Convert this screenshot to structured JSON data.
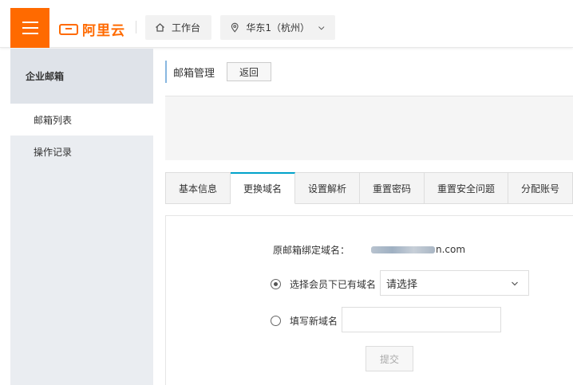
{
  "header": {
    "logo_text": "阿里云",
    "workbench_label": "工作台",
    "region_label": "华东1（杭州）"
  },
  "sidebar": {
    "title": "企业邮箱",
    "items": [
      {
        "label": "邮箱列表",
        "active": true
      },
      {
        "label": "操作记录",
        "active": false
      }
    ]
  },
  "main": {
    "page_title": "邮箱管理",
    "back_label": "返回",
    "tabs": [
      {
        "label": "基本信息",
        "active": false
      },
      {
        "label": "更换域名",
        "active": true
      },
      {
        "label": "设置解析",
        "active": false
      },
      {
        "label": "重置密码",
        "active": false
      },
      {
        "label": "重置安全问题",
        "active": false
      },
      {
        "label": "分配账号",
        "active": false
      }
    ],
    "form": {
      "original_domain_label": "原邮箱绑定域名：",
      "original_domain_suffix": "n.com",
      "option_existing_label": "选择会员下已有域名",
      "option_existing_checked": true,
      "select_value": "请选择",
      "option_new_label": "填写新域名",
      "option_new_checked": false,
      "new_domain_value": "",
      "submit_label": "提交"
    }
  },
  "colors": {
    "brand": "#ff6a00",
    "tab_active_accent": "#00a2ca",
    "sidebar_bg": "#eaedf1"
  }
}
